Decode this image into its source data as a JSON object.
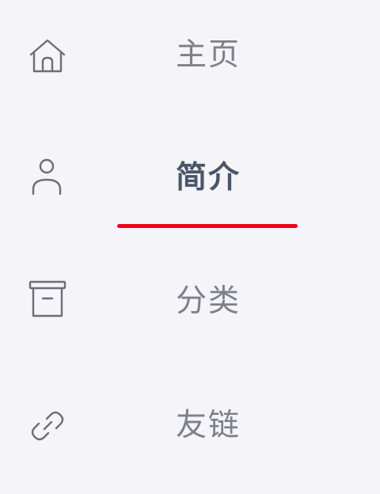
{
  "nav": {
    "items": [
      {
        "label": "主页",
        "icon": "home-icon",
        "active": false
      },
      {
        "label": "简介",
        "icon": "user-icon",
        "active": true
      },
      {
        "label": "分类",
        "icon": "archive-box-icon",
        "active": false
      },
      {
        "label": "友链",
        "icon": "link-icon",
        "active": false
      }
    ]
  },
  "colors": {
    "background": "#f4f4f9",
    "text": "#7d8189",
    "active_text": "#4a5568",
    "underline": "#f0001c"
  }
}
